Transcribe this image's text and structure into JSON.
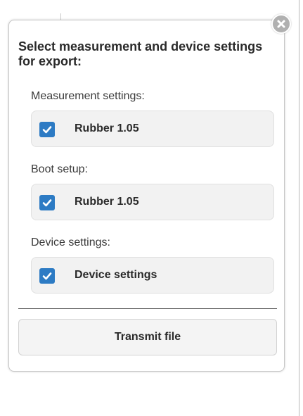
{
  "dialog": {
    "title": "Select measurement and device settings for export:",
    "close_icon": "close-circle-x-icon",
    "sections": [
      {
        "label": "Measurement settings:",
        "option": {
          "label": "Rubber 1.05",
          "checked": true
        }
      },
      {
        "label": "Boot setup:",
        "option": {
          "label": "Rubber 1.05",
          "checked": true
        }
      },
      {
        "label": "Device settings:",
        "option": {
          "label": "Device settings",
          "checked": true
        }
      }
    ],
    "transmit_button": "Transmit file"
  },
  "colors": {
    "checkbox": "#2d7bc4",
    "row_background": "#f2f2f2",
    "close_button": "#b0b0b0"
  }
}
